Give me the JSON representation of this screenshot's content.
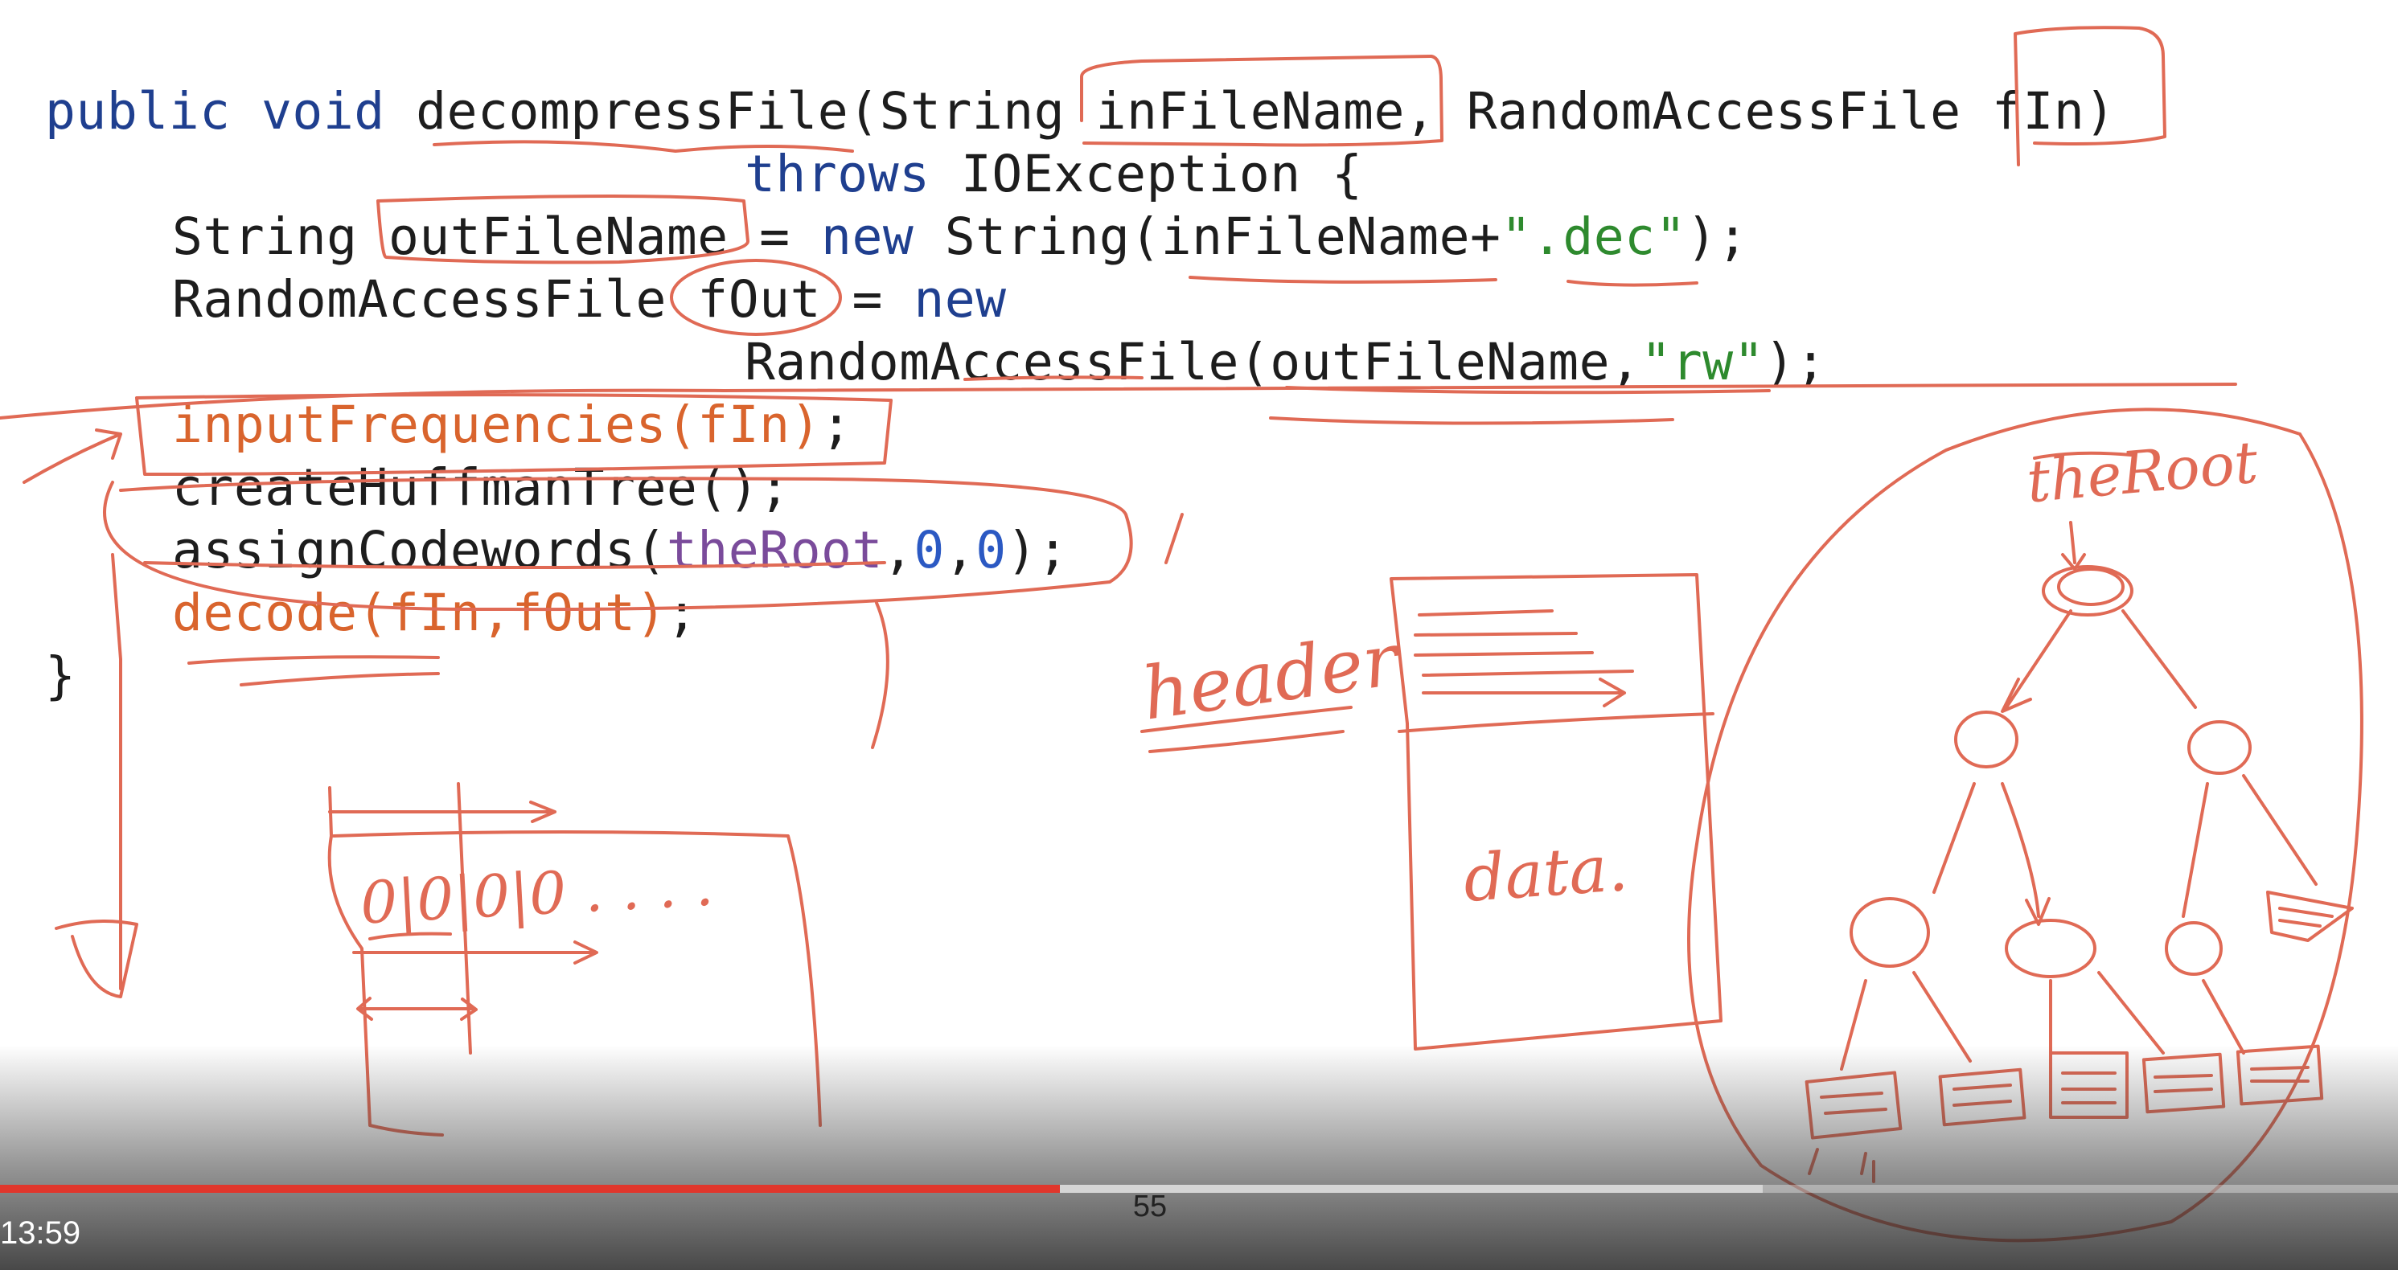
{
  "code_lines": [
    {
      "id": "sig1",
      "parts": [
        {
          "t": "public void ",
          "c": "kw"
        },
        {
          "t": "decompressFile(String inFileName, RandomAccessFile fIn)",
          "c": ""
        }
      ]
    },
    {
      "id": "sig2",
      "parts": [
        {
          "t": "throws",
          "c": "kw"
        },
        {
          "t": " IOException {",
          "c": ""
        }
      ]
    },
    {
      "id": "l3",
      "parts": [
        {
          "t": "String outFileName = ",
          "c": ""
        },
        {
          "t": "new",
          "c": "kw"
        },
        {
          "t": " String(inFileName+",
          "c": ""
        },
        {
          "t": "\".dec\"",
          "c": "str"
        },
        {
          "t": ");",
          "c": ""
        }
      ]
    },
    {
      "id": "l4",
      "parts": [
        {
          "t": "RandomAccessFile fOut = ",
          "c": ""
        },
        {
          "t": "new",
          "c": "kw"
        }
      ]
    },
    {
      "id": "l5",
      "parts": [
        {
          "t": "RandomAccessFile(outFileName,",
          "c": ""
        },
        {
          "t": "\"rw\"",
          "c": "str"
        },
        {
          "t": ");",
          "c": ""
        }
      ]
    },
    {
      "id": "l6",
      "parts": [
        {
          "t": "inputFrequencies(fIn)",
          "c": "hl"
        },
        {
          "t": ";",
          "c": ""
        }
      ]
    },
    {
      "id": "l7",
      "parts": [
        {
          "t": "createHuffmanTree();",
          "c": ""
        }
      ]
    },
    {
      "id": "l8",
      "parts": [
        {
          "t": "assignCodewords(",
          "c": ""
        },
        {
          "t": "theRoot",
          "c": "pur"
        },
        {
          "t": ",",
          "c": ""
        },
        {
          "t": "0",
          "c": "num"
        },
        {
          "t": ",",
          "c": ""
        },
        {
          "t": "0",
          "c": "num"
        },
        {
          "t": ");",
          "c": ""
        }
      ]
    },
    {
      "id": "l9",
      "parts": [
        {
          "t": "decode(fIn,fOut)",
          "c": "hl"
        },
        {
          "t": ";",
          "c": ""
        }
      ]
    },
    {
      "id": "l10",
      "parts": [
        {
          "t": "}",
          "c": ""
        }
      ]
    }
  ],
  "handwriting": {
    "header": "header",
    "data": "data.",
    "the_root": "theRoot",
    "bits": "0|0|0|0 . . . ."
  },
  "player": {
    "slide_number": "55",
    "timestamp": "13:59",
    "played_fraction": 0.442,
    "buffered_fraction": 0.735
  },
  "colors": {
    "keyword": "#1f3f8f",
    "string": "#2e8a2e",
    "highlight": "#d9642d",
    "identifier": "#7a4b9b",
    "ink": "#e06a55",
    "progress": "#e0362c"
  }
}
